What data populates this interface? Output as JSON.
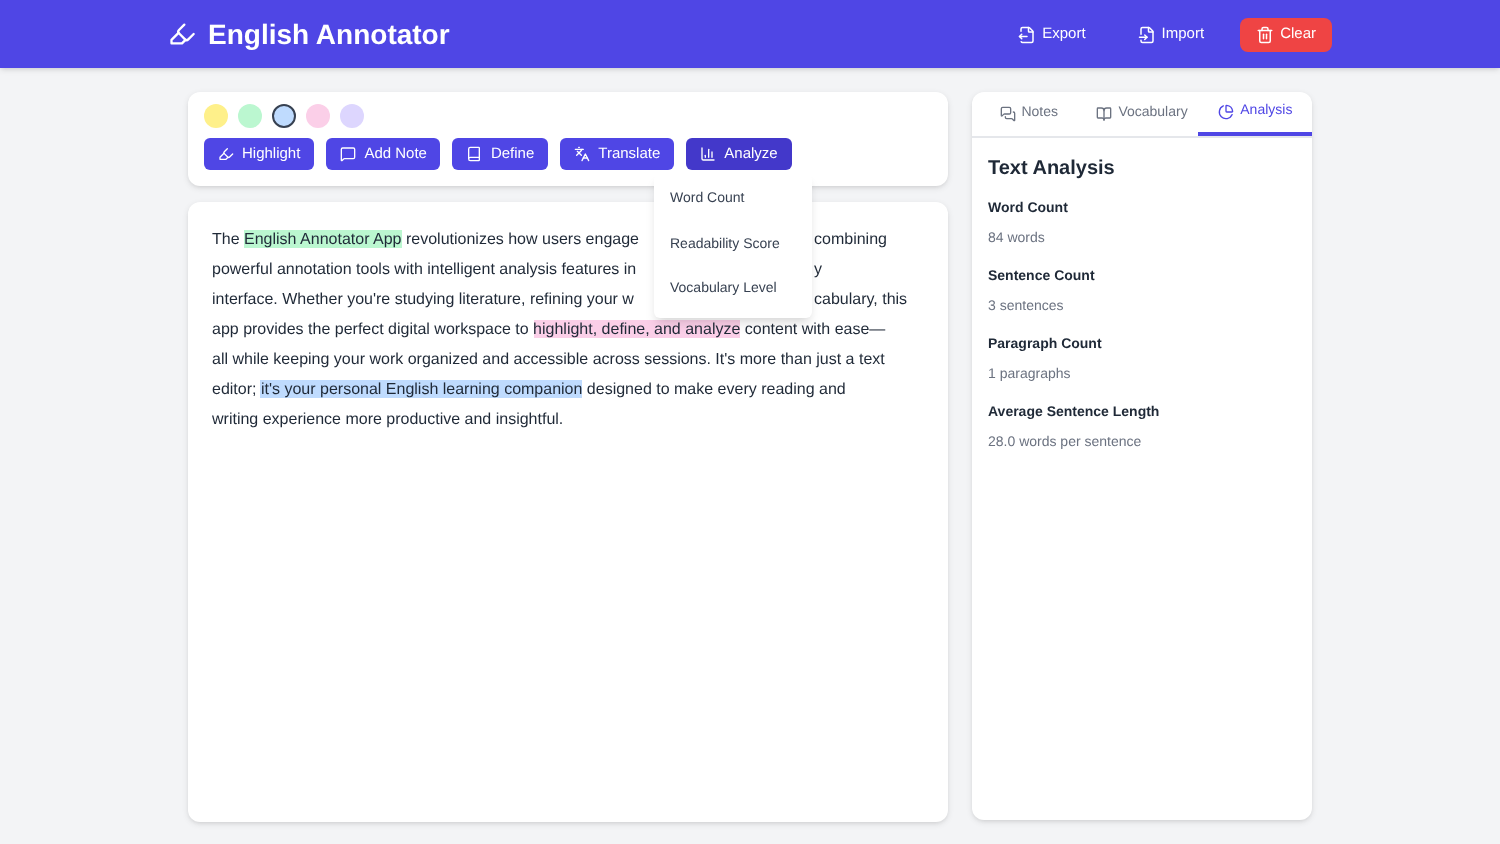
{
  "header": {
    "title": "English Annotator",
    "actions": [
      {
        "label": "Export",
        "kind": "plain"
      },
      {
        "label": "Import",
        "kind": "plain"
      },
      {
        "label": "Clear",
        "kind": "danger"
      }
    ]
  },
  "colors": [
    {
      "color": "#fef08a",
      "selected": false
    },
    {
      "color": "#bbf7d0",
      "selected": false
    },
    {
      "color": "#bfdbfe",
      "selected": true
    },
    {
      "color": "#fbcfe8",
      "selected": false
    },
    {
      "color": "#ddd6fe",
      "selected": false
    }
  ],
  "tools": [
    {
      "label": "Highlight",
      "kind": "highlight",
      "selected": false
    },
    {
      "label": "Add Note",
      "kind": "note",
      "selected": false
    },
    {
      "label": "Define",
      "kind": "define",
      "selected": false
    },
    {
      "label": "Translate",
      "kind": "translate",
      "selected": false
    },
    {
      "label": "Analyze",
      "kind": "analyze",
      "selected": true
    }
  ],
  "menu": [
    "Word Count",
    "Readability Score",
    "Vocabulary Level"
  ],
  "lines": [
    {
      "left": [
        {
          "text": "The "
        },
        {
          "text": "English Annotator App",
          "color": "#bbf7d0"
        },
        {
          "text": " revolutionizes how users engage"
        }
      ],
      "right": [
        {
          "text": "combining"
        }
      ]
    },
    {
      "left": [
        {
          "text": "powerful annotation tools with intelligent analysis features in"
        }
      ],
      "right": [
        {
          "text": "y"
        }
      ]
    },
    {
      "left": [
        {
          "text": "interface. Whether you're studying literature, refining your w"
        }
      ],
      "right": [
        {
          "text": "cabulary, this"
        }
      ]
    },
    {
      "left": [
        {
          "text": "app provides the perfect digital workspace to "
        },
        {
          "text": "highlight, define, and analyze",
          "color": "#fbcfe8"
        },
        {
          "text": " content with ease—"
        }
      ]
    },
    {
      "left": [
        {
          "text": "all while keeping your work organized and accessible across sessions. It's more than just a text"
        }
      ]
    },
    {
      "left": [
        {
          "text": "editor; "
        },
        {
          "text": "it's your personal English learning companion",
          "color": "#bfdbfe"
        },
        {
          "text": " designed to make every reading and"
        }
      ]
    },
    {
      "left": [
        {
          "text": "writing experience more productive and insightful."
        }
      ]
    }
  ],
  "tabs": [
    {
      "label": "Notes",
      "kind": "notes",
      "selected": false
    },
    {
      "label": "Vocabulary",
      "kind": "vocabulary",
      "selected": false
    },
    {
      "label": "Analysis",
      "kind": "analysis",
      "selected": true
    }
  ],
  "analysis": {
    "title": "Text Analysis",
    "stats": [
      {
        "label": "Word Count",
        "value": "84 words"
      },
      {
        "label": "Sentence Count",
        "value": "3 sentences"
      },
      {
        "label": "Paragraph Count",
        "value": "1 paragraphs"
      },
      {
        "label": "Average Sentence Length",
        "value": "28.0 words per sentence"
      }
    ]
  }
}
